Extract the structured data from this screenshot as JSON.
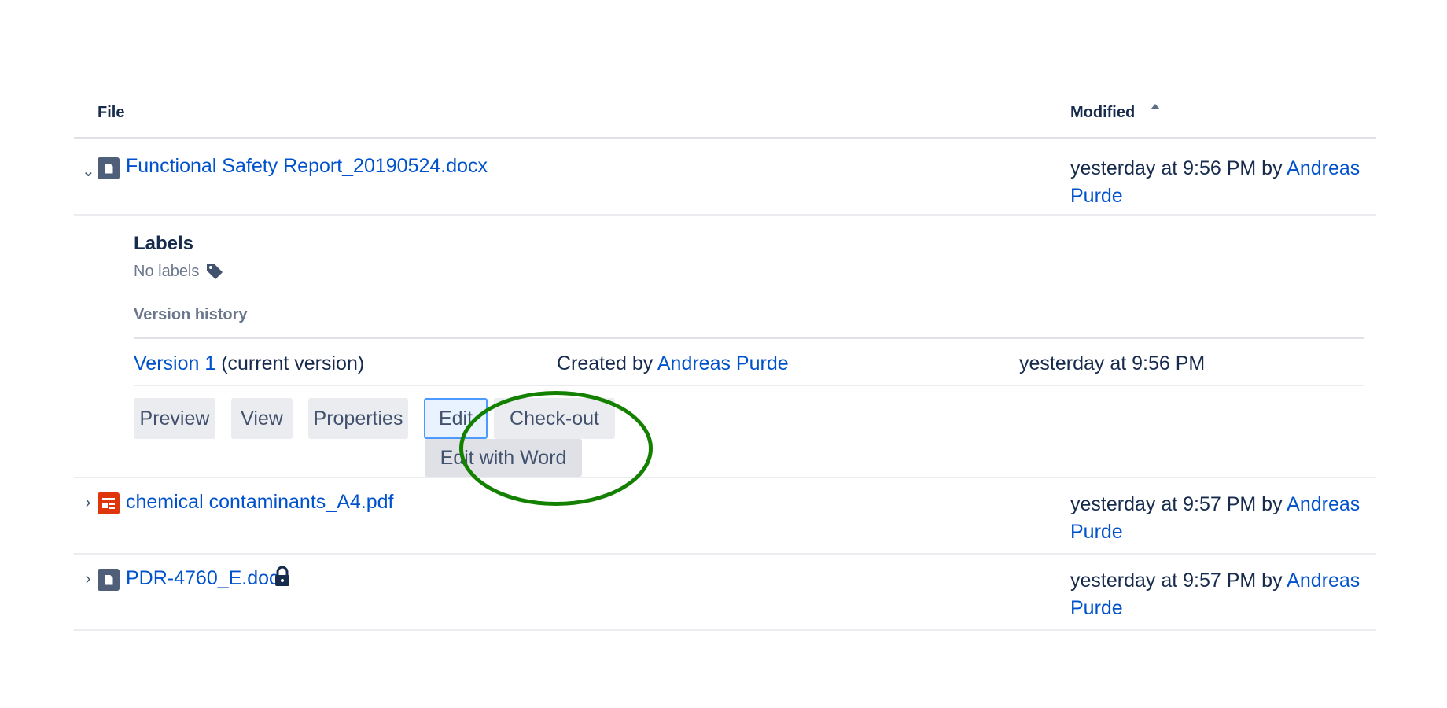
{
  "header": {
    "file": "File",
    "modified": "Modified"
  },
  "files": [
    {
      "name": "Functional Safety Report_20190524.docx",
      "modified_prefix": "yesterday at 9:56 PM by ",
      "modified_user_first": "Andreas",
      "modified_user_last": "Purde",
      "expanded": true,
      "icon": "doc-icon"
    },
    {
      "name": "chemical contaminants_A4.pdf",
      "modified_prefix": "yesterday at 9:57 PM by ",
      "modified_user_first": "Andreas",
      "modified_user_last": "Purde",
      "expanded": false,
      "icon": "pdf-icon"
    },
    {
      "name": "PDR-4760_E.doc",
      "modified_prefix": "yesterday at 9:57 PM by ",
      "modified_user_first": "Andreas",
      "modified_user_last": "Purde",
      "expanded": false,
      "icon": "doc-icon",
      "locked": true
    }
  ],
  "details": {
    "labels_title": "Labels",
    "no_labels": "No labels",
    "version_history_title": "Version history",
    "version": {
      "link": "Version 1",
      "suffix": " (current version)",
      "created_prefix": "Created by ",
      "created_user": "Andreas Purde",
      "date": "yesterday at 9:56 PM"
    },
    "buttons": {
      "preview": "Preview",
      "view": "View",
      "properties": "Properties",
      "edit": "Edit",
      "checkout": "Check-out"
    },
    "edit_dropdown": "Edit with Word"
  },
  "colors": {
    "link": "#0052cc",
    "annotation": "#138000",
    "doc_icon": "#505f79",
    "pdf_icon": "#de350b"
  }
}
